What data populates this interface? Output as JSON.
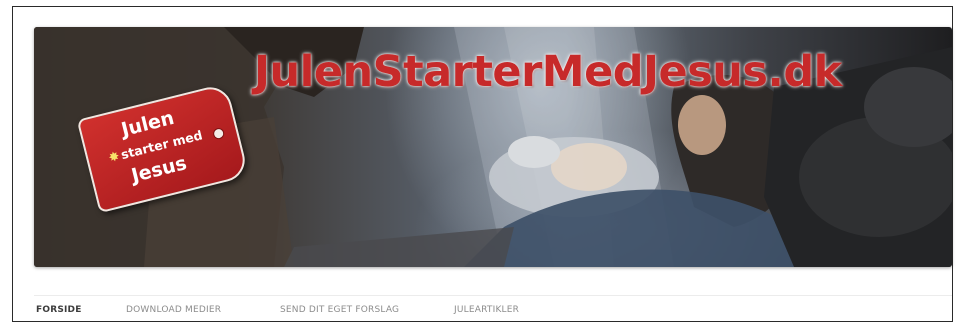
{
  "banner": {
    "site_title": "JulenStarterMedJesus.dk",
    "image_description": "nativity-scene",
    "tag": {
      "line1": "Julen",
      "line2": "starter med",
      "line3": "Jesus",
      "star_glyph": "✸"
    }
  },
  "nav": {
    "items": [
      {
        "label": "FORSIDE",
        "active": true
      },
      {
        "label": "DOWNLOAD MEDIER",
        "active": false
      },
      {
        "label": "SEND DIT EGET FORSLAG",
        "active": false
      },
      {
        "label": "JULEARTIKLER",
        "active": false
      }
    ]
  },
  "colors": {
    "title_red": "#c72a2a",
    "tag_red": "#b82224",
    "nav_active": "#3c3c3c",
    "nav_inactive": "#8c8c8c"
  }
}
